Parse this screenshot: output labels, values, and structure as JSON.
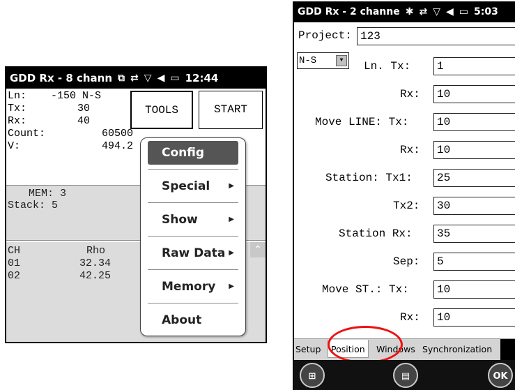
{
  "left": {
    "title": "GDD Rx - 8 chann",
    "time": "12:44",
    "info": {
      "ln_label": "Ln:",
      "ln_value": "-150 N-S",
      "tx_label": "Tx:",
      "tx_value": "30",
      "rx_label": "Rx:",
      "rx_value": "40",
      "count_label": "Count:",
      "count_value": "60500",
      "v_label": "V:",
      "v_value": "494.2"
    },
    "tools_label": "TOOLS",
    "start_label": "START",
    "mem": "MEM: 3",
    "stack": "Stack: 5",
    "table_headers": [
      "CH",
      "Rho"
    ],
    "rows": [
      {
        "ch": "01",
        "rho": "32.34"
      },
      {
        "ch": "02",
        "rho": "42.25"
      }
    ],
    "menu": [
      {
        "label": "Config",
        "selected": true,
        "submenu": false
      },
      {
        "label": "Special",
        "selected": false,
        "submenu": true
      },
      {
        "label": "Show",
        "selected": false,
        "submenu": true
      },
      {
        "label": "Raw Data",
        "selected": false,
        "submenu": true
      },
      {
        "label": "Memory",
        "selected": false,
        "submenu": true
      },
      {
        "label": "About",
        "selected": false,
        "submenu": false
      }
    ]
  },
  "right": {
    "title": "GDD Rx - 2 channe",
    "time": "5:03",
    "project_label": "Project:",
    "project_value": "123",
    "direction_value": "N-S",
    "fields": [
      {
        "label": "Ln. Tx:",
        "value": "1"
      },
      {
        "label": "Rx:",
        "value": "10"
      },
      {
        "label": "Move LINE: Tx:",
        "value": "10"
      },
      {
        "label": "Rx:",
        "value": "10"
      },
      {
        "label": "Station: Tx1:",
        "value": "25"
      },
      {
        "label": "Tx2:",
        "value": "30"
      },
      {
        "label": "Station Rx:",
        "value": "35"
      },
      {
        "label": "Sep:",
        "value": "5"
      },
      {
        "label": "Move ST.: Tx:",
        "value": "10"
      },
      {
        "label": "Rx:",
        "value": "10"
      }
    ],
    "tabs": [
      "Setup",
      "Position",
      "Windows",
      "Synchronization"
    ],
    "active_tab": "Position",
    "ok_label": "OK"
  },
  "colors": {
    "highlight_ring": "#e11111",
    "titlebar": "#000000",
    "menu_selected": "#555555"
  }
}
